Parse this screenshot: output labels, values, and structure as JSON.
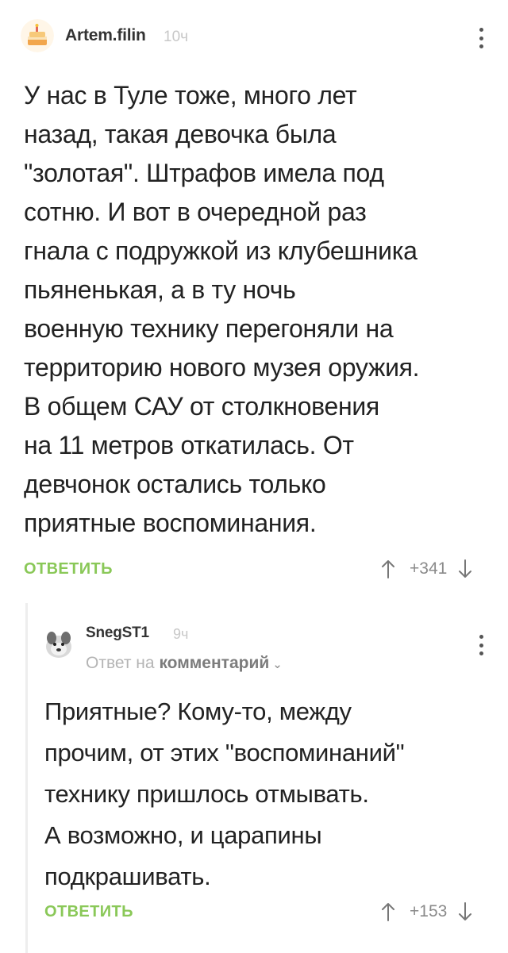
{
  "comments": [
    {
      "username": "Artem.filin",
      "time": "10ч",
      "avatar_icon": "cake-icon",
      "lines": [
        "У нас в Туле тоже, много лет",
        "назад, такая девочка была",
        "\"золотая\". Штрафов имела под",
        "сотню. И вот в очередной раз",
        "гнала с подружкой из клубешника",
        "пьяненькая, а в ту ночь",
        "военную технику перегоняли на",
        "территорию нового музея оружия.",
        "В общем САУ от столкновения",
        "на 11 метров откатилась. От",
        "девчонок остались только",
        "приятные воспоминания."
      ],
      "reply_label": "ОТВЕТИТЬ",
      "score": "+341"
    },
    {
      "username": "SnegST1",
      "time": "9ч",
      "avatar_icon": "dog-avatar-icon",
      "reply_to_prefix": "Ответ на",
      "reply_to_link": "комментарий",
      "reply_to_chevron": "⌄",
      "lines": [
        "Приятные? Кому-то, между",
        "прочим, от этих \"воспоминаний\"",
        "технику пришлось отмывать.",
        "А возможно, и царапины",
        "подкрашивать."
      ],
      "reply_label": "ОТВЕТИТЬ",
      "score": "+153"
    }
  ],
  "colors": {
    "accent_green": "#8ac858",
    "text": "#222222",
    "muted": "#b4b4b4"
  }
}
